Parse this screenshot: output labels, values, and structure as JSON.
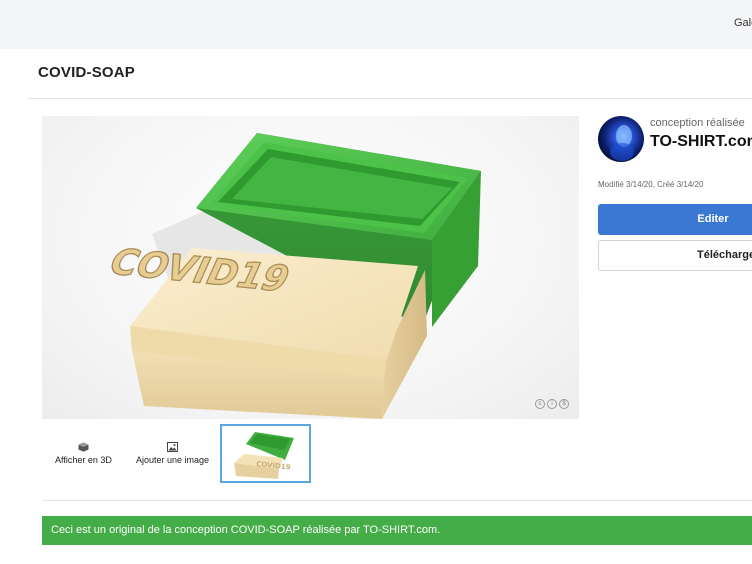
{
  "header": {
    "nav_label": "Gale"
  },
  "page": {
    "title": "COVID-SOAP"
  },
  "viewer": {
    "model_text": "COVID19",
    "license_icons": [
      "cc-icon",
      "by-icon",
      "nc-icon"
    ]
  },
  "thumbnails": {
    "view3d_label": "Afficher en 3D",
    "add_image_label": "Ajouter une image"
  },
  "designer": {
    "byline": "conception réalisée",
    "name": "TO-SHIRT.com"
  },
  "dates": "Modifié 3/14/20, Créé 3/14/20",
  "actions": {
    "edit_label": "Editer",
    "download_label": "Télécharge"
  },
  "banner": {
    "text": "Ceci est un original de la conception COVID-SOAP réalisée par TO-SHIRT.com."
  },
  "colors": {
    "accent_blue": "#3a78d4",
    "banner_green": "#44ad47",
    "mold_green": "#3fae3f",
    "soap_cream": "#f3e2b8"
  }
}
